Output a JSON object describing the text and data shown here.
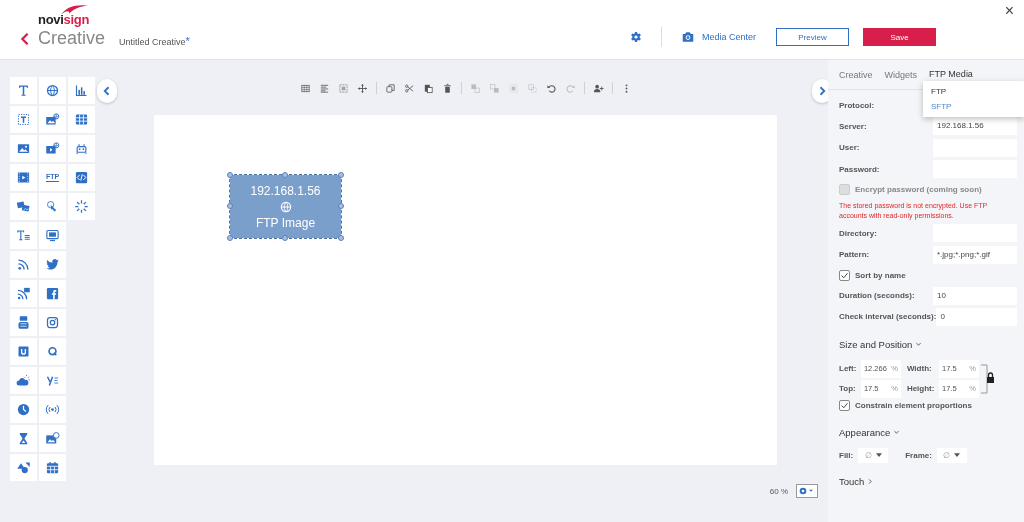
{
  "header": {
    "logo_1": "novi",
    "logo_2": "sign",
    "title": "Creative",
    "document": "Untitled Creative",
    "unsaved_mark": "*",
    "media_center": "Media Center",
    "preview": "Preview",
    "save": "Save",
    "close": "×"
  },
  "palette": {
    "ftp_label": "FTP"
  },
  "toolbar": [
    {
      "disabled": false
    },
    {
      "disabled": false
    },
    {
      "disabled": false
    },
    {
      "disabled": false
    },
    {
      "disabled": false
    },
    {
      "disabled": false
    },
    {
      "disabled": false
    },
    {
      "disabled": false
    },
    {
      "disabled": true
    },
    {
      "disabled": true
    },
    {
      "disabled": true
    },
    {
      "disabled": true
    },
    {
      "disabled": false
    },
    {
      "disabled": true
    },
    {
      "disabled": false
    },
    {
      "disabled": false
    }
  ],
  "canvas": {
    "elements": [
      {
        "line_1": "192.168.1.56",
        "line_2": "FTP Image",
        "selected": true
      }
    ],
    "zoom": "60 %"
  },
  "properties": {
    "tabs": [
      {
        "label": "Creative",
        "selected": false
      },
      {
        "label": "Widgets",
        "selected": false
      },
      {
        "label": "FTP Media",
        "selected": true
      }
    ],
    "protocol_menu": {
      "options": [
        {
          "label": "FTP",
          "selected": false
        },
        {
          "label": "SFTP",
          "selected": true
        }
      ]
    },
    "rows": [
      {
        "kind": "select",
        "label": "Protocol:"
      },
      {
        "kind": "field",
        "label": "Server:",
        "value": "192.168.1.56"
      },
      {
        "kind": "field",
        "label": "User:"
      },
      {
        "kind": "field",
        "label": "Password:"
      },
      {
        "kind": "checkbox",
        "label": "Encrypt password (coming soon)",
        "checked": false,
        "disabled": true
      },
      {
        "kind": "warning",
        "text": "The stored password is not encrypted. Use FTP accounts with read-only permissions."
      },
      {
        "kind": "field",
        "label": "Directory:"
      },
      {
        "kind": "field",
        "label": "Pattern:",
        "value": "*.jpg;*.png;*.gif"
      },
      {
        "kind": "checkbox",
        "label": "Sort by name",
        "checked": true,
        "disabled": false
      },
      {
        "kind": "field",
        "label": "Duration (seconds):",
        "value": "10"
      },
      {
        "kind": "field",
        "label": "Check interval (seconds):",
        "value": "0"
      }
    ],
    "size_position": {
      "title": "Size and Position",
      "expanded": true,
      "fields": [
        {
          "label": "Left:",
          "value": "12.266",
          "unit": "%"
        },
        {
          "label": "Width:",
          "value": "17.5",
          "unit": "%"
        },
        {
          "label": "Top:",
          "value": "17.5",
          "unit": "%"
        },
        {
          "label": "Height:",
          "value": "17.5",
          "unit": "%"
        }
      ],
      "constrain": {
        "label": "Constrain element proportions",
        "checked": true
      }
    },
    "appearance": {
      "title": "Appearance",
      "expanded": true,
      "fill": {
        "label": "Fill:",
        "value": "∅"
      },
      "frame": {
        "label": "Frame:",
        "value": "∅"
      }
    },
    "touch": {
      "title": "Touch",
      "expanded": false
    }
  }
}
